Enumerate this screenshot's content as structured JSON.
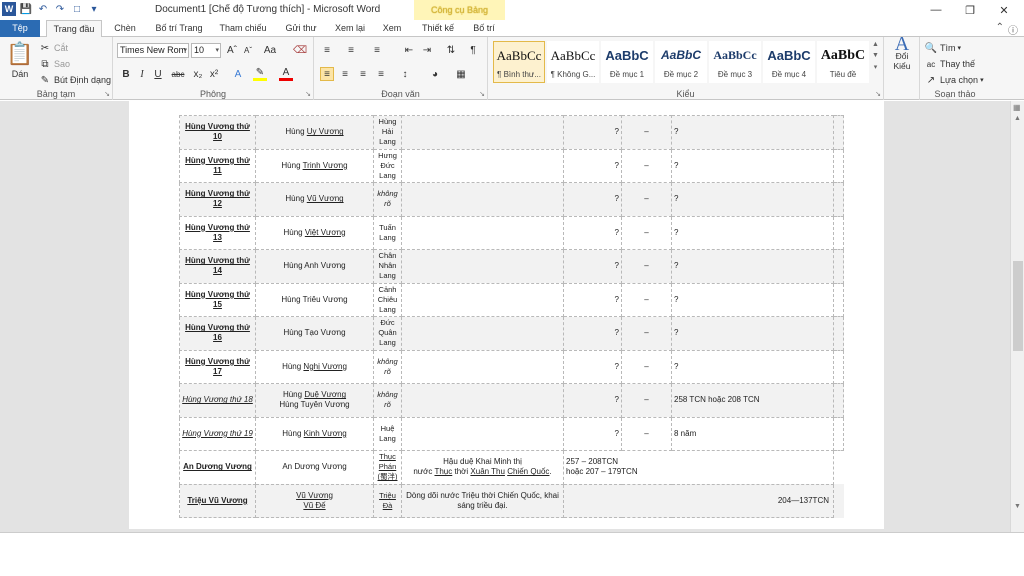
{
  "window": {
    "title": "Document1 [Chế độ Tương thích] - Microsoft Word",
    "context_tab_header": "Công cụ Bảng"
  },
  "tabs": [
    {
      "label": "Tệp"
    },
    {
      "label": "Trang đầu"
    },
    {
      "label": "Chèn"
    },
    {
      "label": "Bố trí Trang"
    },
    {
      "label": "Tham chiếu"
    },
    {
      "label": "Gửi thư"
    },
    {
      "label": "Xem lại"
    },
    {
      "label": "Xem"
    },
    {
      "label": "Thiết kế"
    },
    {
      "label": "Bố trí"
    }
  ],
  "ribbon": {
    "clipboard": {
      "label": "Bảng tạm",
      "paste": "Dán",
      "cut": "Cắt",
      "copy": "Sao",
      "format_painter": "Bút Định dạng"
    },
    "font": {
      "label": "Phông",
      "font_name": "Times New Rom",
      "font_size": "10"
    },
    "paragraph": {
      "label": "Đoạn văn"
    },
    "styles": {
      "label": "Kiểu",
      "items": [
        {
          "sample": "AaBbCc",
          "name": "¶ Bình thư..."
        },
        {
          "sample": "AaBbCc",
          "name": "¶ Không G..."
        },
        {
          "sample": "AaBbC",
          "name": "Đề mục 1"
        },
        {
          "sample": "AaBbC",
          "name": "Đề mục 2"
        },
        {
          "sample": "AaBbCc",
          "name": "Đề mục 3"
        },
        {
          "sample": "AaBbC",
          "name": "Đề mục 4"
        },
        {
          "sample": "AaBbC",
          "name": "Tiêu đề"
        }
      ],
      "change_styles": "Đổi Kiểu"
    },
    "editing": {
      "label": "Soạn thảo",
      "find": "Tìm",
      "replace": "Thay thế",
      "select": "Lựa chọn"
    }
  },
  "table": {
    "rows": [
      {
        "name": "Hùng Vương thứ 10",
        "title_prefix": "Hùng ",
        "title_u": "Uy Vương",
        "capital": "Hùng Hải Lang",
        "q": "?",
        "dash": "–",
        "last": "?"
      },
      {
        "name": "Hùng Vương thứ 11",
        "title_prefix": "Hùng ",
        "title_u": "Trinh Vương",
        "capital": "Hưng Đức Lang",
        "q": "?",
        "dash": "–",
        "last": "?"
      },
      {
        "name": "Hùng Vương thứ 12",
        "title_prefix": "Hùng ",
        "title_u": "Vũ Vương",
        "capital": "không rõ",
        "capital_italic": true,
        "q": "?",
        "dash": "–",
        "last": "?"
      },
      {
        "name": "Hùng Vương thứ 13",
        "title_prefix": "Hùng ",
        "title_u": "Việt Vương",
        "capital": "Tuấn Lang",
        "q": "?",
        "dash": "–",
        "last": "?"
      },
      {
        "name": "Hùng Vương thứ 14",
        "title_prefix": "Hùng Anh Vương",
        "title_u": "",
        "capital": "Chân Nhân Lang",
        "q": "?",
        "dash": "–",
        "last": "?"
      },
      {
        "name": "Hùng Vương thứ 15",
        "title_prefix": "Hùng Triêu Vương",
        "title_u": "",
        "capital": "Cảnh Chiêu Lang",
        "q": "?",
        "dash": "–",
        "last": "?"
      },
      {
        "name": "Hùng Vương thứ 16",
        "title_prefix": "Hùng Tạo Vương",
        "title_u": "",
        "capital": "Đức Quân Lang",
        "q": "?",
        "dash": "–",
        "last": "?"
      },
      {
        "name": "Hùng Vương thứ 17",
        "title_prefix": "Hùng ",
        "title_u": "Nghị Vương",
        "capital": "không rõ",
        "capital_italic": true,
        "q": "?",
        "dash": "–",
        "last": "?"
      },
      {
        "name": "Hùng Vương thứ 18",
        "name_plain": true,
        "title_prefix": "Hùng ",
        "title_u": "Duệ Vương",
        "title_line2": "Hùng Tuyên Vương",
        "capital": "không rõ",
        "capital_italic": true,
        "q": "?",
        "dash": "–",
        "last": "258 TCN hoặc 208 TCN"
      },
      {
        "name": "Hùng Vương thứ 19",
        "name_plain": true,
        "title_prefix": "Hùng ",
        "title_u": "Kinh Vương",
        "capital": "Huệ Lang",
        "q": "?",
        "dash": "–",
        "last": "8 năm"
      }
    ],
    "an_duong": {
      "name": "An Dương Vương",
      "title": "An Dương Vương",
      "capital": "Thục Phán (蜀泮)",
      "desc_line1": "Hậu duệ Khai Minh thị",
      "desc_line2_pre": "nước ",
      "desc_line2_u1": "Thục",
      "desc_line2_mid": " thời ",
      "desc_line2_u2": "Xuân Thu",
      "desc_line2_sp": " ",
      "desc_line2_u3": "Chiến Quốc",
      "desc_line2_end": ".",
      "years1": "257 – 208TCN",
      "years2": "hoặc 207 – 179TCN"
    },
    "trieu": {
      "name": "Triệu Vũ Vương",
      "title1": "Vũ Vương",
      "title2": "Vũ Đế",
      "capital": "Triệu Đà",
      "desc": "Dòng dõi nước Triệu thời Chiến Quốc, khai sáng triều đại.",
      "years": "204—137TCN"
    }
  }
}
